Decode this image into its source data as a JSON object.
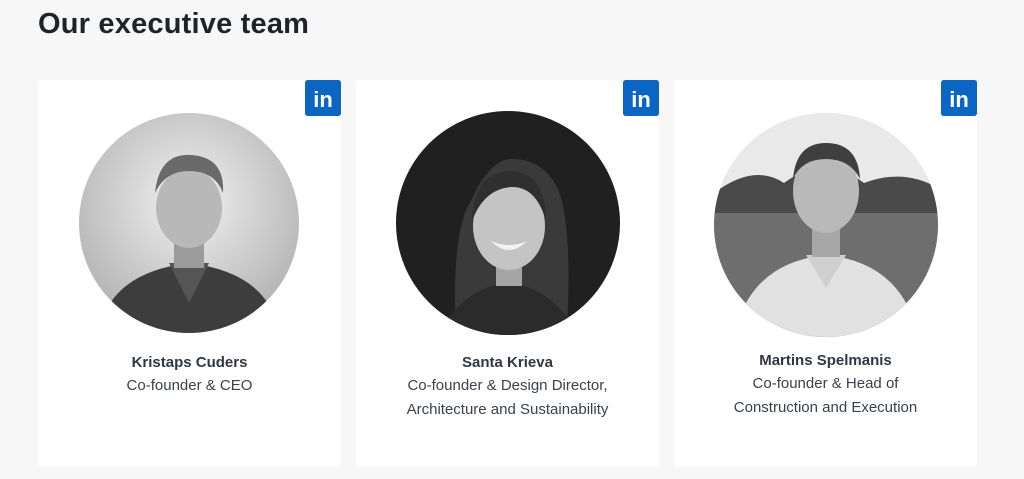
{
  "section": {
    "title": "Our executive team"
  },
  "team": [
    {
      "name": "Kristaps Cuders",
      "role_lines": [
        "Co-founder & CEO"
      ],
      "social_icon": "linkedin-icon",
      "social_label": "in"
    },
    {
      "name": "Santa Krieva",
      "role_lines": [
        "Co-founder & Design Director,",
        "Architecture and Sustainability"
      ],
      "social_icon": "linkedin-icon",
      "social_label": "in"
    },
    {
      "name": "Martins Spelmanis",
      "role_lines": [
        "Co-founder & Head of",
        "Construction and Execution"
      ],
      "social_icon": "linkedin-icon",
      "social_label": "in"
    }
  ],
  "colors": {
    "page_background": "#f7f7f7",
    "card_background": "#ffffff",
    "linkedin_blue": "#0a66c2",
    "heading": "#1f2329",
    "text": "#3a414d"
  }
}
